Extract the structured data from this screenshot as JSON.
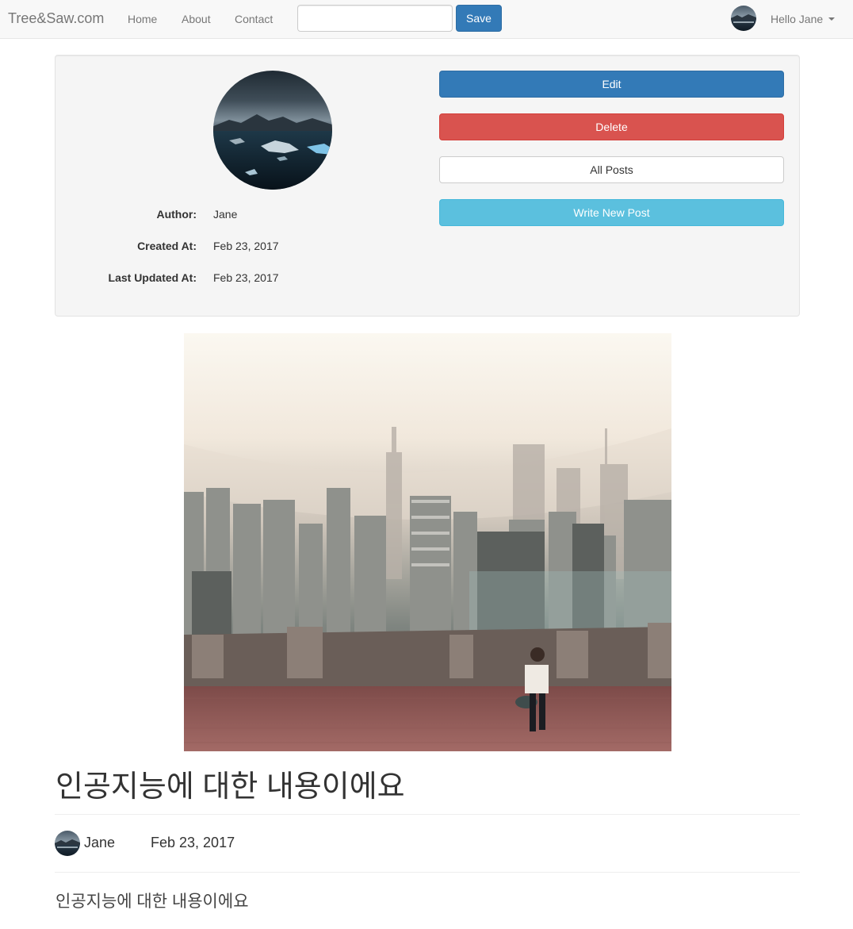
{
  "navbar": {
    "brand": "Tree&Saw.com",
    "links": [
      "Home",
      "About",
      "Contact"
    ],
    "search_value": "",
    "save_label": "Save",
    "user_greeting": "Hello Jane"
  },
  "profile": {
    "fields": [
      {
        "label": "Author:",
        "value": "Jane"
      },
      {
        "label": "Created At:",
        "value": "Feb 23, 2017"
      },
      {
        "label": "Last Updated At:",
        "value": "Feb 23, 2017"
      }
    ],
    "buttons": {
      "edit": "Edit",
      "delete": "Delete",
      "all_posts": "All Posts",
      "write_new": "Write New Post"
    }
  },
  "post": {
    "title": "인공지능에 대한 내용이에요",
    "author": "Jane",
    "date": "Feb 23, 2017",
    "body": "인공지능에 대한 내용이에요"
  },
  "colors": {
    "primary": "#337ab7",
    "danger": "#d9534f",
    "info": "#5bc0de",
    "navbar_bg": "#f8f8f8",
    "well_bg": "#f5f5f5"
  },
  "icons": {
    "avatar": "avatar-icon",
    "caret": "caret-down-icon"
  }
}
